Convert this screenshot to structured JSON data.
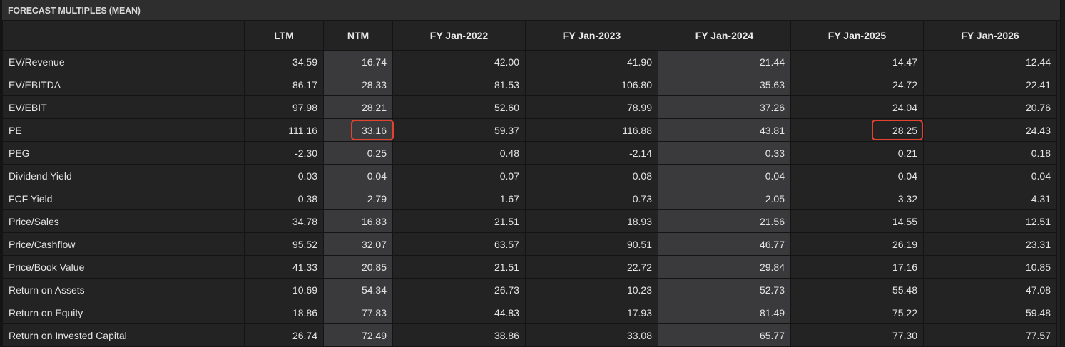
{
  "panel": {
    "title": "FORECAST MULTIPLES (MEAN)"
  },
  "table": {
    "columns": [
      "",
      "LTM",
      "NTM",
      "FY Jan-2022",
      "FY Jan-2023",
      "FY Jan-2024",
      "FY Jan-2025",
      "FY Jan-2026"
    ],
    "rows": [
      {
        "label": "EV/Revenue",
        "values": [
          "34.59",
          "16.74",
          "42.00",
          "41.90",
          "21.44",
          "14.47",
          "12.44"
        ]
      },
      {
        "label": "EV/EBITDA",
        "values": [
          "86.17",
          "28.33",
          "81.53",
          "106.80",
          "35.63",
          "24.72",
          "22.41"
        ]
      },
      {
        "label": "EV/EBIT",
        "values": [
          "97.98",
          "28.21",
          "52.60",
          "78.99",
          "37.26",
          "24.04",
          "20.76"
        ]
      },
      {
        "label": "PE",
        "values": [
          "111.16",
          "33.16",
          "59.37",
          "116.88",
          "43.81",
          "28.25",
          "24.43"
        ]
      },
      {
        "label": "PEG",
        "values": [
          "-2.30",
          "0.25",
          "0.48",
          "-2.14",
          "0.33",
          "0.21",
          "0.18"
        ]
      },
      {
        "label": "Dividend Yield",
        "values": [
          "0.03",
          "0.04",
          "0.07",
          "0.08",
          "0.04",
          "0.04",
          "0.04"
        ]
      },
      {
        "label": "FCF Yield",
        "values": [
          "0.38",
          "2.79",
          "1.67",
          "0.73",
          "2.05",
          "3.32",
          "4.31"
        ]
      },
      {
        "label": "Price/Sales",
        "values": [
          "34.78",
          "16.83",
          "21.51",
          "18.93",
          "21.56",
          "14.55",
          "12.51"
        ]
      },
      {
        "label": "Price/Cashflow",
        "values": [
          "95.52",
          "32.07",
          "63.57",
          "90.51",
          "46.77",
          "26.19",
          "23.31"
        ]
      },
      {
        "label": "Price/Book Value",
        "values": [
          "41.33",
          "20.85",
          "21.51",
          "22.72",
          "29.84",
          "17.16",
          "10.85"
        ]
      },
      {
        "label": "Return on Assets",
        "values": [
          "10.69",
          "54.34",
          "26.73",
          "10.23",
          "52.73",
          "55.48",
          "47.08"
        ]
      },
      {
        "label": "Return on Equity",
        "values": [
          "18.86",
          "77.83",
          "44.83",
          "17.93",
          "81.49",
          "75.22",
          "59.48"
        ]
      },
      {
        "label": "Return on Invested Capital",
        "values": [
          "26.74",
          "72.49",
          "38.86",
          "33.08",
          "65.77",
          "77.30",
          "77.57"
        ]
      }
    ]
  },
  "highlight": {
    "box_color": "#e2432e",
    "shaded_columns": [
      "NTM",
      "FY Jan-2024"
    ],
    "boxed_cells": [
      {
        "row": "PE",
        "column": "NTM"
      },
      {
        "row": "PE",
        "column": "FY Jan-2025"
      }
    ]
  }
}
